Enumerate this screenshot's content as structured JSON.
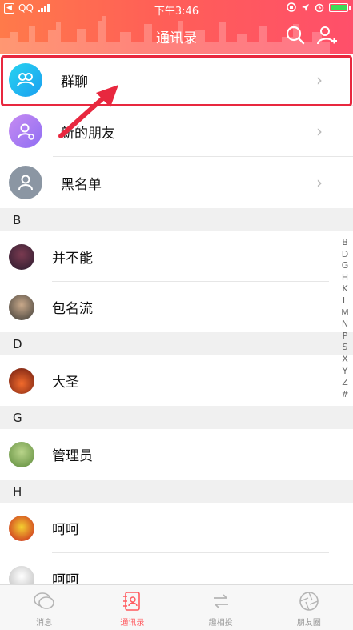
{
  "status_bar": {
    "carrier": "QQ",
    "time": "下午3:46"
  },
  "header": {
    "title": "通讯录"
  },
  "entries": [
    {
      "label": "群聊"
    },
    {
      "label": "新的朋友"
    },
    {
      "label": "黑名单"
    }
  ],
  "sections": [
    {
      "letter": "B",
      "contacts": [
        "并不能",
        "包名流"
      ]
    },
    {
      "letter": "D",
      "contacts": [
        "大圣"
      ]
    },
    {
      "letter": "G",
      "contacts": [
        "管理员"
      ]
    },
    {
      "letter": "H",
      "contacts": [
        "呵呵",
        "呵呵"
      ]
    }
  ],
  "index_letters": [
    "B",
    "D",
    "G",
    "H",
    "K",
    "L",
    "M",
    "N",
    "P",
    "S",
    "X",
    "Y",
    "Z",
    "#"
  ],
  "tabs": [
    {
      "label": "消息"
    },
    {
      "label": "通讯录"
    },
    {
      "label": "趣相投"
    },
    {
      "label": "朋友圈"
    }
  ],
  "colors": {
    "accent": "#ff5a5f",
    "highlight": "#e8283f",
    "header_start": "#ff7a4a",
    "header_end": "#ff4f6a"
  }
}
